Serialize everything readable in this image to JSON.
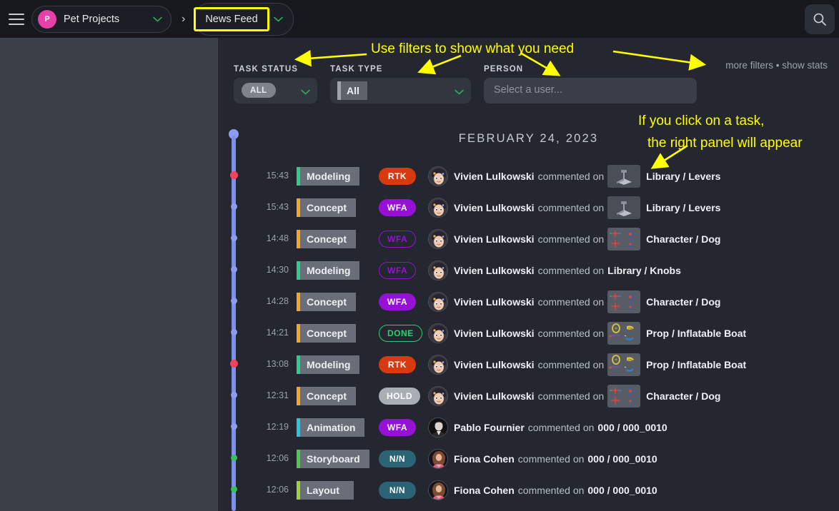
{
  "topbar": {
    "menu_icon": "hamburger-menu-icon",
    "project": {
      "initial": "P",
      "name": "Pet Projects",
      "chevron": "chevron-down-icon"
    },
    "separator": "›",
    "feed": {
      "name": "News Feed",
      "chevron": "chevron-down-icon"
    },
    "search_icon": "search-icon"
  },
  "filters": {
    "status": {
      "label": "TASK STATUS",
      "value": "ALL"
    },
    "type": {
      "label": "TASK TYPE",
      "value": "All"
    },
    "person": {
      "label": "PERSON",
      "placeholder": "Select a user..."
    },
    "more_filters": "more filters • show stats"
  },
  "date_header": "FEBRUARY 24, 2023",
  "annotations": [
    "Use filters to show what you need",
    "If you click on a task,",
    "the right panel will appear"
  ],
  "colors": {
    "accent_pink": "#e83fa8",
    "highlight_yellow": "#ffff00",
    "timeline_blue": "#8d9bf0",
    "dot_red": "#f2415c",
    "dot_green": "#35c15c",
    "status_rtk": "#d83a0e",
    "status_wfa": "#9610d6",
    "status_done": "#2ecc71",
    "status_hold": "#a9adb4",
    "status_nn": "#2d6475",
    "type_modeling": "#2ecb8c",
    "type_concept": "#f5a623",
    "type_animation": "#29c4e0",
    "type_storyboard": "#4cc94c",
    "type_layout": "#9fd13c",
    "sidebar_bg": "#3c4049",
    "main_bg": "#24272f",
    "topbar_bg": "#16181d"
  },
  "feed": [
    {
      "time": "15:43",
      "type": "Modeling",
      "type_color": "#2ecb8c",
      "status": "RTK",
      "status_style": "solid",
      "status_color": "#d83a0e",
      "user": "Vivien Lulkowski",
      "avatar": "vivien",
      "action": "commented on",
      "thumb": "lever",
      "entity": "Library / Levers",
      "dot": "red"
    },
    {
      "time": "15:43",
      "type": "Concept",
      "type_color": "#f5a623",
      "status": "WFA",
      "status_style": "solid",
      "status_color": "#9610d6",
      "user": "Vivien Lulkowski",
      "avatar": "vivien",
      "action": "commented on",
      "thumb": "lever",
      "entity": "Library / Levers",
      "dot": "blue"
    },
    {
      "time": "14:48",
      "type": "Concept",
      "type_color": "#f5a623",
      "status": "WFA",
      "status_style": "outline",
      "status_color": "#9610d6",
      "user": "Vivien Lulkowski",
      "avatar": "vivien",
      "action": "commented on",
      "thumb": "rig",
      "entity": "Character / Dog",
      "dot": "blue"
    },
    {
      "time": "14:30",
      "type": "Modeling",
      "type_color": "#2ecb8c",
      "status": "WFA",
      "status_style": "outline",
      "status_color": "#9610d6",
      "user": "Vivien Lulkowski",
      "avatar": "vivien",
      "action": "commented on",
      "thumb": "none",
      "entity": "Library / Knobs",
      "dot": "blue"
    },
    {
      "time": "14:28",
      "type": "Concept",
      "type_color": "#f5a623",
      "status": "WFA",
      "status_style": "solid",
      "status_color": "#9610d6",
      "user": "Vivien Lulkowski",
      "avatar": "vivien",
      "action": "commented on",
      "thumb": "rig",
      "entity": "Character / Dog",
      "dot": "blue"
    },
    {
      "time": "14:21",
      "type": "Concept",
      "type_color": "#f5a623",
      "status": "DONE",
      "status_style": "outline",
      "status_color": "#2ecc71",
      "user": "Vivien Lulkowski",
      "avatar": "vivien",
      "action": "commented on",
      "thumb": "boat",
      "entity": "Prop / Inflatable Boat",
      "dot": "blue"
    },
    {
      "time": "13:08",
      "type": "Modeling",
      "type_color": "#2ecb8c",
      "status": "RTK",
      "status_style": "solid",
      "status_color": "#d83a0e",
      "user": "Vivien Lulkowski",
      "avatar": "vivien",
      "action": "commented on",
      "thumb": "boat",
      "entity": "Prop / Inflatable Boat",
      "dot": "red"
    },
    {
      "time": "12:31",
      "type": "Concept",
      "type_color": "#f5a623",
      "status": "HOLD",
      "status_style": "solid",
      "status_color": "#a9adb4",
      "user": "Vivien Lulkowski",
      "avatar": "vivien",
      "action": "commented on",
      "thumb": "rig",
      "entity": "Character / Dog",
      "dot": "blue"
    },
    {
      "time": "12:19",
      "type": "Animation",
      "type_color": "#29c4e0",
      "status": "WFA",
      "status_style": "solid",
      "status_color": "#9610d6",
      "user": "Pablo Fournier",
      "avatar": "pablo",
      "action": "commented on",
      "thumb": "none",
      "entity": "000 / 000_0010",
      "dot": "blue"
    },
    {
      "time": "12:06",
      "type": "Storyboard",
      "type_color": "#4cc94c",
      "status": "N/N",
      "status_style": "solid",
      "status_color": "#2d6475",
      "user": "Fiona Cohen",
      "avatar": "fiona",
      "action": "commented on",
      "thumb": "none",
      "entity": "000 / 000_0010",
      "dot": "green"
    },
    {
      "time": "12:06",
      "type": "Layout",
      "type_color": "#9fd13c",
      "status": "N/N",
      "status_style": "solid",
      "status_color": "#2d6475",
      "user": "Fiona Cohen",
      "avatar": "fiona",
      "action": "commented on",
      "thumb": "none",
      "entity": "000 / 000_0010",
      "dot": "green"
    }
  ]
}
